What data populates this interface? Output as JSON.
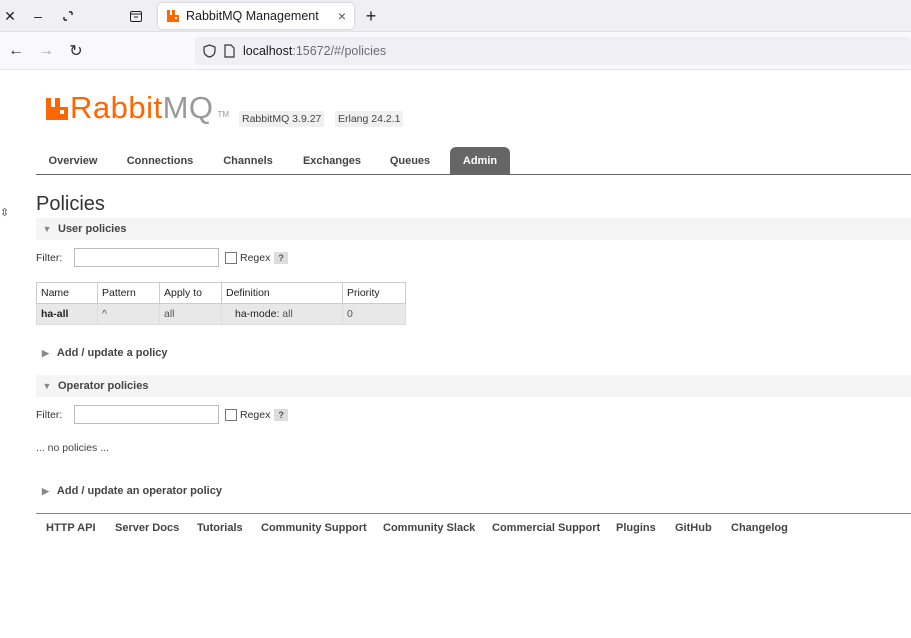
{
  "browser": {
    "tab_title": "RabbitMQ Management",
    "url_host": "localhost",
    "url_path": ":15672/#/policies"
  },
  "header": {
    "logo_rabbit": "Rabbit",
    "logo_mq": "MQ",
    "logo_tm": "TM",
    "version": "RabbitMQ 3.9.27",
    "erlang": "Erlang 24.2.1",
    "brand_color": "#ff6600"
  },
  "nav": {
    "tabs": [
      "Overview",
      "Connections",
      "Channels",
      "Exchanges",
      "Queues",
      "Admin"
    ],
    "active": "Admin"
  },
  "page": {
    "title": "Policies",
    "user_policies": {
      "heading": "User policies",
      "filter_label": "Filter:",
      "filter_value": "",
      "regex_label": "Regex",
      "help": "?",
      "columns": [
        "Name",
        "Pattern",
        "Apply to",
        "Definition",
        "Priority"
      ],
      "rows": [
        {
          "name": "ha-all",
          "pattern": "^",
          "apply_to": "all",
          "def_key": "ha-mode:",
          "def_value": "all",
          "priority": "0"
        }
      ]
    },
    "add_policy": "Add / update a policy",
    "operator_policies": {
      "heading": "Operator policies",
      "filter_label": "Filter:",
      "filter_value": "",
      "regex_label": "Regex",
      "help": "?",
      "empty_text": "... no policies ..."
    },
    "add_operator_policy": "Add / update an operator policy"
  },
  "footer": {
    "links": [
      "HTTP API",
      "Server Docs",
      "Tutorials",
      "Community Support",
      "Community Slack",
      "Commercial Support",
      "Plugins",
      "GitHub",
      "Changelog"
    ]
  }
}
